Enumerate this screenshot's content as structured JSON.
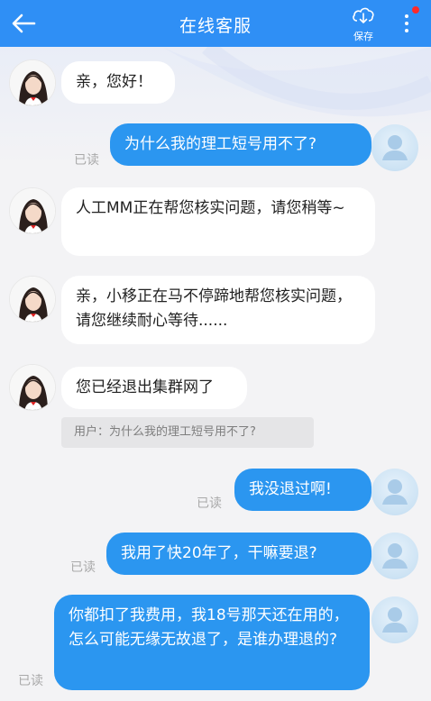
{
  "header": {
    "title": "在线客服",
    "save_label": "保存"
  },
  "messages": [
    {
      "text": "亲，您好！"
    },
    {
      "text": "为什么我的理工短号用不了?",
      "status": "已读"
    },
    {
      "text": "人工MM正在帮您核实问题，请您稍等~"
    },
    {
      "text": "亲，小移正在马不停蹄地帮您核实问题，请您继续耐心等待......"
    },
    {
      "text": "您已经退出集群网了"
    },
    {
      "text": "我没退过啊!",
      "status": "已读"
    },
    {
      "text": "我用了快20年了，干嘛要退?",
      "status": "已读"
    },
    {
      "text": "你都扣了我费用，我18号那天还在用的，怎么可能无缘无故退了，是谁办理退的?",
      "status": "已读"
    }
  ],
  "quote": {
    "text": "用户：为什么我的理工短号用不了?"
  },
  "colors": {
    "header": "#2f8ff5",
    "user_bubble": "#2b96f0",
    "agent_bubble": "#ffffff",
    "notification_dot": "#ff2a2a"
  },
  "icons": [
    "back-arrow-icon",
    "cloud-download-icon",
    "more-vertical-icon",
    "agent-avatar",
    "user-avatar"
  ]
}
